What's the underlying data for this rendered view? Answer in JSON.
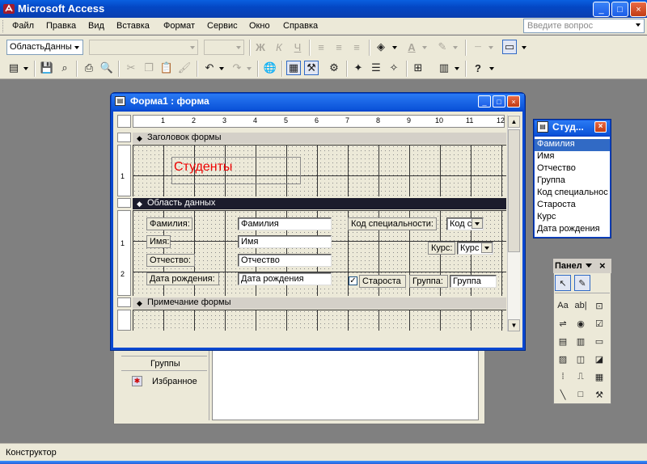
{
  "app": {
    "title": "Microsoft Access",
    "minimize": "_",
    "maximize": "□",
    "close": "×"
  },
  "menu": {
    "items": [
      "Файл",
      "Правка",
      "Вид",
      "Вставка",
      "Формат",
      "Сервис",
      "Окно",
      "Справка"
    ],
    "ask_placeholder": "Введите вопрос"
  },
  "toolbar": {
    "object_combo": "ОбластьДанны",
    "font_combo": "",
    "size_combo": "",
    "bold": "Ж",
    "italic": "К",
    "underline": "Ч"
  },
  "nav": {
    "groups_label": "Группы",
    "favorites_label": "Избранное"
  },
  "form_window": {
    "title": "Форма1 : форма",
    "ruler_h": [
      "1",
      "2",
      "3",
      "4",
      "5",
      "6",
      "7",
      "8",
      "9",
      "10",
      "11",
      "12"
    ],
    "ruler_v_header": [
      "1"
    ],
    "ruler_v_detail": [
      "1",
      "2"
    ],
    "header_section": "Заголовок формы",
    "detail_section": "Область данных",
    "footer_section": "Примечание формы",
    "title_label": "Студенты",
    "controls": {
      "surname_label": "Фамилия:",
      "surname_field": "Фамилия",
      "name_label": "Имя:",
      "name_field": "Имя",
      "patronymic_label": "Отчество:",
      "patronymic_field": "Отчество",
      "birthdate_label": "Дата рождения:",
      "birthdate_field": "Дата рождения",
      "spec_code_label": "Код специальности:",
      "spec_code_field": "Код с",
      "course_label": "Курс:",
      "course_field": "Курс",
      "headman_label": "Староста",
      "headman_checked": "✓",
      "group_label": "Группа:",
      "group_field": "Группа"
    }
  },
  "field_list": {
    "title": "Студ...",
    "items": [
      "Фамилия",
      "Имя",
      "Отчество",
      "Группа",
      "Код специальнос",
      "Староста",
      "Курс",
      "Дата рождения"
    ]
  },
  "toolbox": {
    "title": "Панел",
    "tools": [
      "Aa",
      "ab|"
    ]
  },
  "status": {
    "text": "Конструктор"
  },
  "colors": {
    "titlebar": "#0a52d8",
    "form_title_text": "#e00000",
    "selection": "#316ac5"
  }
}
